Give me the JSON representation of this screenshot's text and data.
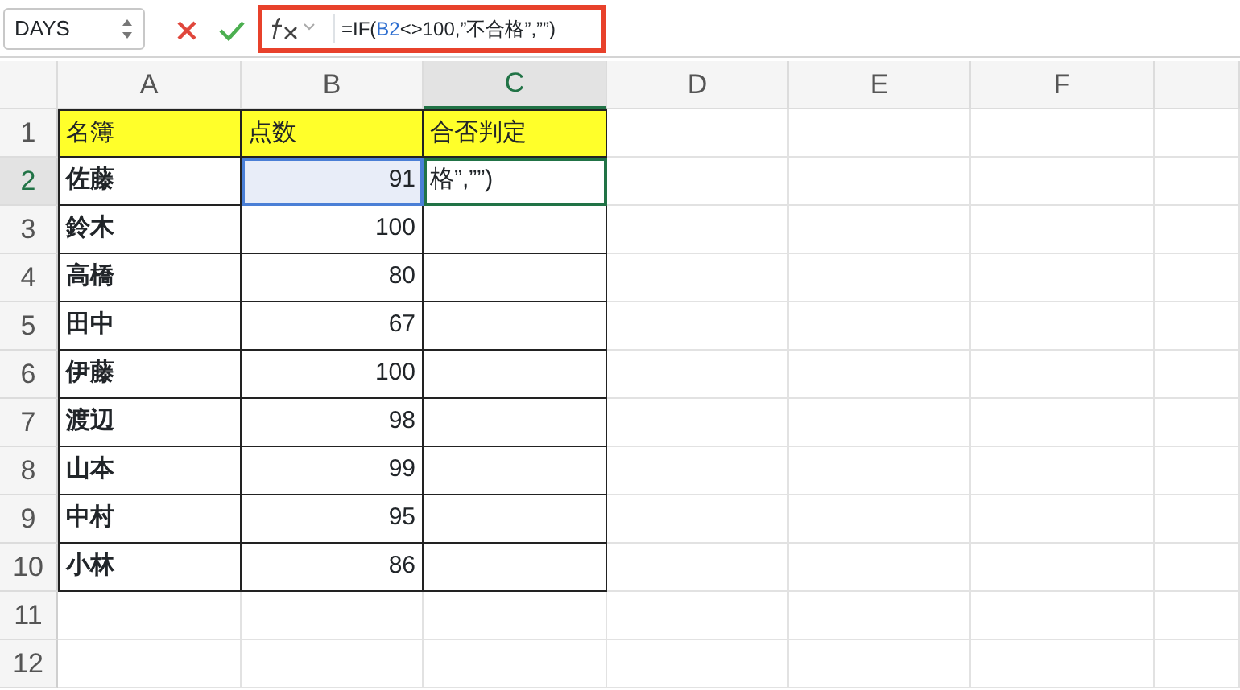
{
  "name_box": "DAYS",
  "formula": [
    {
      "text": "=IF(",
      "ref": false
    },
    {
      "text": "B2",
      "ref": true
    },
    {
      "text": "<>100,”不合格”,””)",
      "ref": false
    }
  ],
  "columns": [
    {
      "label": "A",
      "active": false
    },
    {
      "label": "B",
      "active": false
    },
    {
      "label": "C",
      "active": true
    },
    {
      "label": "D",
      "active": false
    },
    {
      "label": "E",
      "active": false
    },
    {
      "label": "F",
      "active": false
    }
  ],
  "rows": [
    {
      "number": "1",
      "kind": "header",
      "active": false,
      "cells": [
        {
          "text": "名簿",
          "selected": false,
          "editing": false
        },
        {
          "text": "点数",
          "selected": false,
          "editing": false
        },
        {
          "text": "合否判定",
          "selected": false,
          "editing": false
        }
      ]
    },
    {
      "number": "2",
      "kind": "data",
      "active": true,
      "cells": [
        {
          "text": "佐藤",
          "selected": false,
          "editing": false
        },
        {
          "text": "91",
          "selected": true,
          "editing": false
        },
        {
          "text": "格”,””)",
          "selected": false,
          "editing": true
        }
      ]
    },
    {
      "number": "3",
      "kind": "data",
      "active": false,
      "cells": [
        {
          "text": "鈴木",
          "selected": false,
          "editing": false
        },
        {
          "text": "100",
          "selected": false,
          "editing": false
        },
        {
          "text": "",
          "selected": false,
          "editing": false
        }
      ]
    },
    {
      "number": "4",
      "kind": "data",
      "active": false,
      "cells": [
        {
          "text": "高橋",
          "selected": false,
          "editing": false
        },
        {
          "text": "80",
          "selected": false,
          "editing": false
        },
        {
          "text": "",
          "selected": false,
          "editing": false
        }
      ]
    },
    {
      "number": "5",
      "kind": "data",
      "active": false,
      "cells": [
        {
          "text": "田中",
          "selected": false,
          "editing": false
        },
        {
          "text": "67",
          "selected": false,
          "editing": false
        },
        {
          "text": "",
          "selected": false,
          "editing": false
        }
      ]
    },
    {
      "number": "6",
      "kind": "data",
      "active": false,
      "cells": [
        {
          "text": "伊藤",
          "selected": false,
          "editing": false
        },
        {
          "text": "100",
          "selected": false,
          "editing": false
        },
        {
          "text": "",
          "selected": false,
          "editing": false
        }
      ]
    },
    {
      "number": "7",
      "kind": "data",
      "active": false,
      "cells": [
        {
          "text": "渡辺",
          "selected": false,
          "editing": false
        },
        {
          "text": "98",
          "selected": false,
          "editing": false
        },
        {
          "text": "",
          "selected": false,
          "editing": false
        }
      ]
    },
    {
      "number": "8",
      "kind": "data",
      "active": false,
      "cells": [
        {
          "text": "山本",
          "selected": false,
          "editing": false
        },
        {
          "text": "99",
          "selected": false,
          "editing": false
        },
        {
          "text": "",
          "selected": false,
          "editing": false
        }
      ]
    },
    {
      "number": "9",
      "kind": "data",
      "active": false,
      "cells": [
        {
          "text": "中村",
          "selected": false,
          "editing": false
        },
        {
          "text": "95",
          "selected": false,
          "editing": false
        },
        {
          "text": "",
          "selected": false,
          "editing": false
        }
      ]
    },
    {
      "number": "10",
      "kind": "data",
      "active": false,
      "cells": [
        {
          "text": "小林",
          "selected": false,
          "editing": false
        },
        {
          "text": "86",
          "selected": false,
          "editing": false
        },
        {
          "text": "",
          "selected": false,
          "editing": false
        }
      ]
    },
    {
      "number": "11",
      "kind": "empty",
      "active": false,
      "cells": []
    },
    {
      "number": "12",
      "kind": "empty",
      "active": false,
      "cells": []
    }
  ]
}
